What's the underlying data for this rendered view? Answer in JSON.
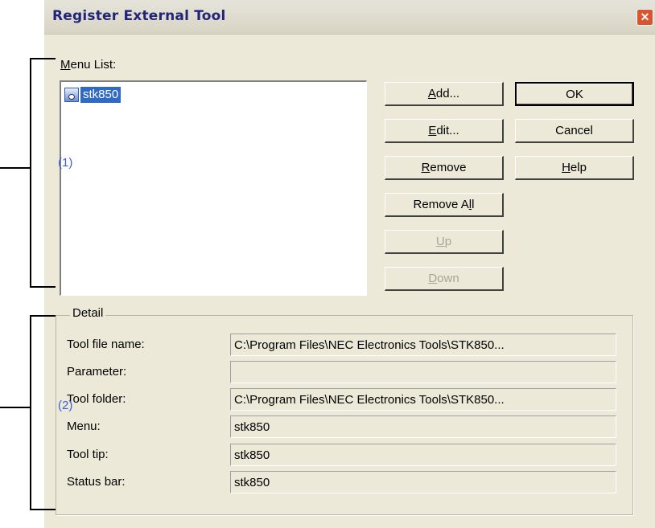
{
  "window": {
    "title": "Register External Tool",
    "close_glyph": "✕"
  },
  "menu_list": {
    "label": "Menu List:",
    "items": [
      {
        "label": "stk850",
        "icon": "tool-icon",
        "selected": true
      }
    ]
  },
  "buttons": {
    "add": "Add...",
    "edit": "Edit...",
    "remove": "Remove",
    "remove_all": "Remove All",
    "up": "Up",
    "down": "Down",
    "ok": "OK",
    "cancel": "Cancel",
    "help": "Help"
  },
  "detail": {
    "title": "Detail",
    "fields": [
      {
        "label": "Tool file name:",
        "value": "C:\\Program Files\\NEC Electronics Tools\\STK850..."
      },
      {
        "label": "Parameter:",
        "value": ""
      },
      {
        "label": "Tool folder:",
        "value": "C:\\Program Files\\NEC Electronics Tools\\STK850..."
      },
      {
        "label": "Menu:",
        "value": "stk850"
      },
      {
        "label": "Tool tip:",
        "value": "stk850"
      },
      {
        "label": "Status bar:",
        "value": "stk850"
      }
    ]
  },
  "annotations": {
    "section1": "(1)",
    "section2": "(2)"
  },
  "colors": {
    "dialog_bg": "#ece9d8",
    "title_text": "#20257a",
    "selection": "#316ac5",
    "annotation": "#3b62d8"
  }
}
